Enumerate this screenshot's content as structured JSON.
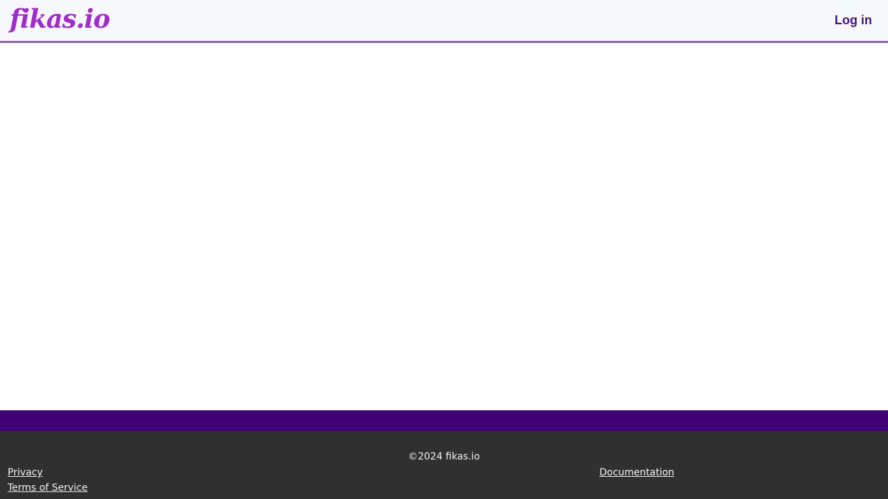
{
  "header": {
    "logo_text": "fikas.io",
    "login_label": "Log in"
  },
  "footer": {
    "copyright": "©2024 fikas.io",
    "links": {
      "privacy": "Privacy",
      "terms": "Terms of Service",
      "documentation": "Documentation"
    }
  },
  "colors": {
    "brand_purple": "#a02dc8",
    "login_text": "#42127a",
    "header_border": "#8a63a8",
    "band": "#3f0075",
    "footer_bg": "#303030"
  }
}
